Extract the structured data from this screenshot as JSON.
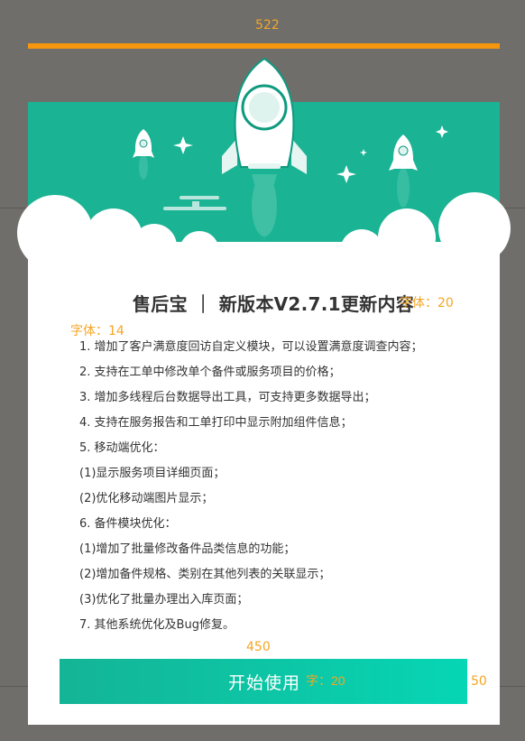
{
  "annotations": {
    "width_top": "522",
    "title_font": "字体：20",
    "body_font": "字体：14",
    "button_width": "450",
    "button_font": "字：20",
    "button_height": "50"
  },
  "dialog": {
    "title": "售后宝  ｜  新版本V2.7.1更新内容",
    "notes": [
      "1. 增加了客户满意度回访自定义模块，可以设置满意度调查内容；",
      "2. 支持在工单中修改单个备件或服务项目的价格；",
      "3. 增加多线程后台数据导出工具，可支持更多数据导出；",
      "4. 支持在服务报告和工单打印中显示附加组件信息；",
      "5. 移动端优化：",
      "(1)显示服务项目详细页面；",
      "(2)优化移动端图片显示；",
      "6. 备件模块优化：",
      "(1)增加了批量修改备件品类信息的功能；",
      "(2)增加备件规格、类别在其他列表的关联显示；",
      "(3)优化了批量办理出入库页面；",
      "7. 其他系统优化及Bug修复。"
    ],
    "start_button_label": "开始使用"
  },
  "colors": {
    "teal": "#1ab394",
    "accent": "#f5960f",
    "backdrop": "#6f6e6b"
  },
  "icons": [
    "rocket-icon",
    "small-rocket-icon",
    "sparkle-icon",
    "cloud-shape"
  ]
}
